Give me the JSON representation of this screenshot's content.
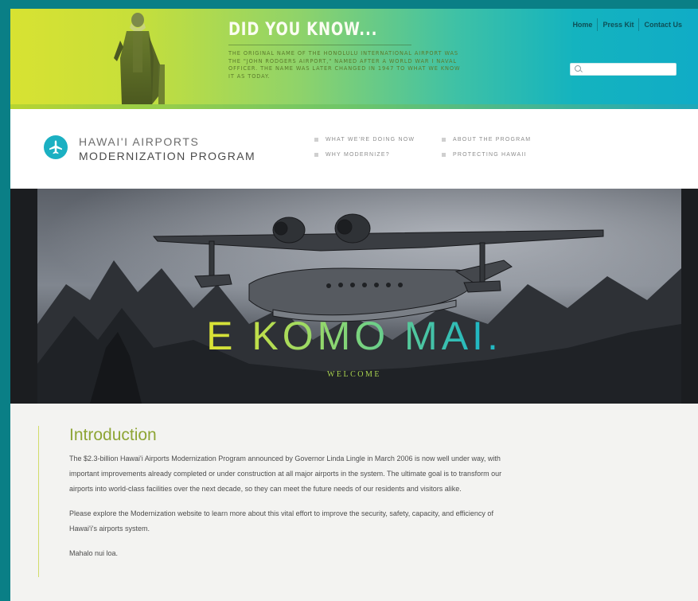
{
  "banner": {
    "title": "DID YOU KNOW...",
    "body": "The original name of the Honolulu International Airport was the \"John Rodgers Airport,\" named after a World War I naval officer. The name was later changed in 1947 to what we know it as today."
  },
  "top_nav": {
    "items": [
      "Home",
      "Press Kit",
      "Contact Us"
    ]
  },
  "search": {
    "placeholder": ""
  },
  "logo": {
    "line1": "HAWAI'I AIRPORTS",
    "line2": "MODERNIZATION PROGRAM"
  },
  "main_nav": {
    "items": [
      "What we're doing now",
      "About the program",
      "Why modernize?",
      "Protecting Hawaii"
    ]
  },
  "hero": {
    "title": "E KOMO MAI.",
    "subtitle": "WELCOME"
  },
  "intro": {
    "heading": "Introduction",
    "paragraphs": [
      "The $2.3-billion Hawai'i Airports Modernization Program announced by Governor Linda Lingle in March 2006 is now well under way, with important improvements already completed or under construction at all major airports in the system. The ultimate goal is to transform our airports into world-class facilities over the next decade, so they can meet the future needs of our residents and visitors alike.",
      "Please explore the Modernization website to learn more about this vital effort to improve the security, safety, capacity, and efficiency of Hawai'i's airports system.",
      "Mahalo nui loa."
    ]
  },
  "colors": {
    "page_background": "#0a7f86",
    "accent_green": "#8ea535",
    "accent_teal": "#1bb0c2"
  }
}
